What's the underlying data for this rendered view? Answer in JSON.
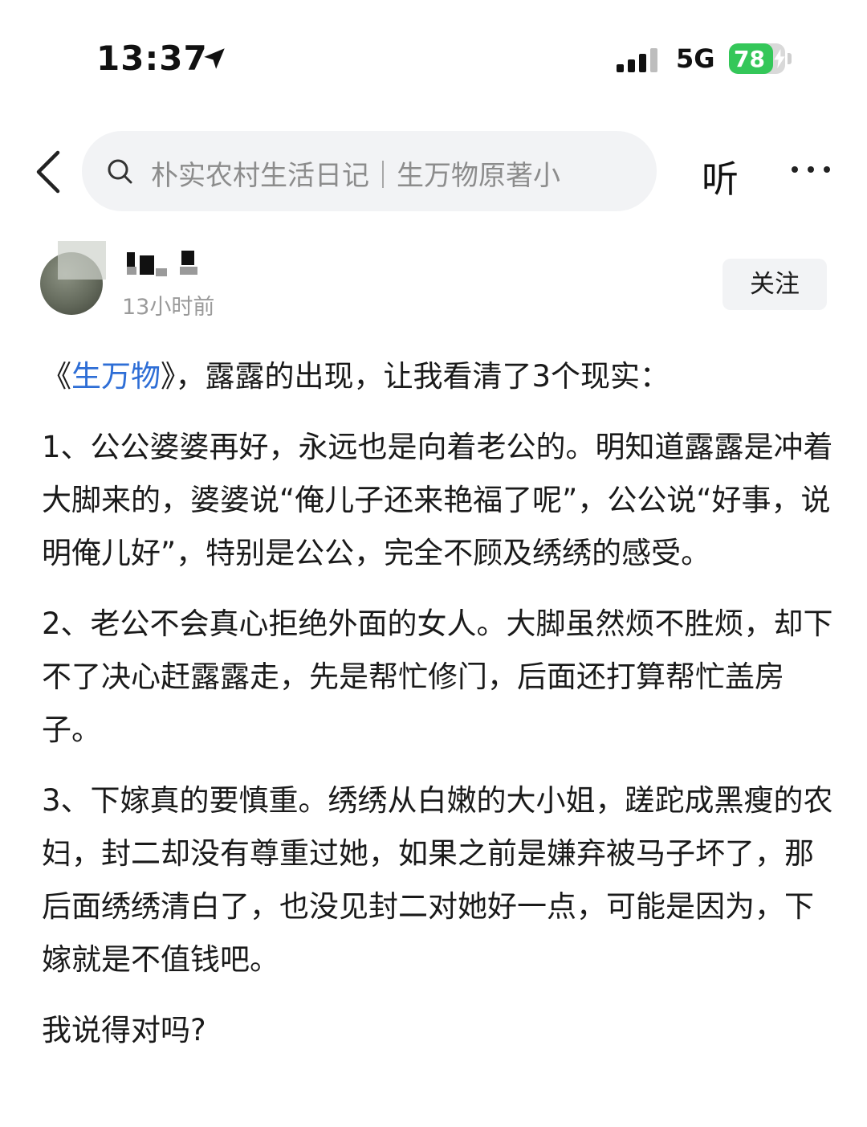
{
  "status_bar": {
    "time": "13:37",
    "network": "5G",
    "battery_level": "78",
    "battery_fraction": 0.78
  },
  "nav": {
    "search_text": "朴实农村生活日记｜生万物原著小",
    "listen_label": "听"
  },
  "author": {
    "time_ago": "13小时前",
    "follow_label": "关注"
  },
  "post": {
    "title_prefix": "《",
    "title_link": "生万物",
    "title_rest": "》，露露的出现，让我看清了3个现实：",
    "point1": "1、公公婆婆再好，永远也是向着老公的。明知道露露是冲着大脚来的，婆婆说“俺儿子还来艳福了呢”，公公说“好事，说明俺儿好”，特别是公公，完全不顾及绣绣的感受。",
    "point2": "2、老公不会真心拒绝外面的女人。大脚虽然烦不胜烦，却下不了决心赶露露走，先是帮忙修门，后面还打算帮忙盖房子。",
    "point3": "3、下嫁真的要慎重。绣绣从白嫩的大小姐，蹉跎成黑瘦的农妇，封二却没有尊重过她，如果之前是嫌弃被马子坏了，那后面绣绣清白了，也没见封二对她好一点，可能是因为，下嫁就是不值钱吧。",
    "closing": "我说得对吗?"
  },
  "colors": {
    "accent_link": "#2e6ed6",
    "battery_green": "#34c759",
    "search_bg": "#f2f3f5",
    "muted_text": "#9a9a9a"
  },
  "icons": [
    "location-arrow-icon",
    "signal-bars-icon",
    "battery-icon",
    "back-chevron-icon",
    "search-icon",
    "more-dots-icon"
  ]
}
